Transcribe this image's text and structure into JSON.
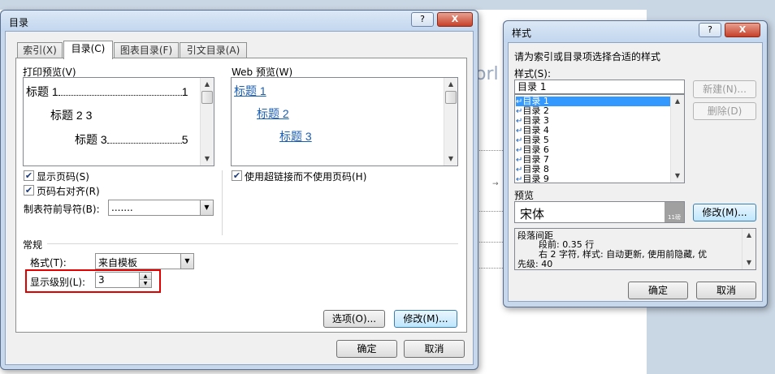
{
  "background_doc": {
    "fragment": "orl"
  },
  "toc_dialog": {
    "title": "目录",
    "title_buttons": {
      "help": "?",
      "close": "X"
    },
    "tabs": [
      {
        "label": "索引(X)",
        "active": false
      },
      {
        "label": "目录(C)",
        "active": true
      },
      {
        "label": "图表目录(F)",
        "active": false
      },
      {
        "label": "引文目录(A)",
        "active": false
      }
    ],
    "print_preview": {
      "label": "打印预览(V)",
      "lines": [
        {
          "text": "标题 1",
          "page": "1"
        },
        {
          "text": "标题 2",
          "page": "3"
        },
        {
          "text": "标题 3",
          "page": "5"
        }
      ]
    },
    "web_preview": {
      "label": "Web 预览(W)",
      "links": [
        "标题 1",
        "标题 2",
        "标题 3"
      ]
    },
    "options": {
      "show_page_numbers": {
        "label": "显示页码(S)",
        "checked": true
      },
      "right_align": {
        "label": "页码右对齐(R)",
        "checked": true
      },
      "use_hyperlinks": {
        "label": "使用超链接而不使用页码(H)",
        "checked": true
      },
      "tab_leader": {
        "label": "制表符前导符(B):",
        "value": "......."
      }
    },
    "general": {
      "heading": "常规",
      "format": {
        "label": "格式(T):",
        "value": "来自模板"
      },
      "levels": {
        "label": "显示级别(L):",
        "value": "3"
      }
    },
    "buttons": {
      "options": "选项(O)...",
      "modify": "修改(M)...",
      "ok": "确定",
      "cancel": "取消"
    }
  },
  "style_dialog": {
    "title": "样式",
    "title_buttons": {
      "help": "?",
      "close": "X"
    },
    "instruction": "请为索引或目录项选择合适的样式",
    "styles_label": "样式(S):",
    "style_input": "目录 1",
    "style_list": [
      {
        "label": "目录 1",
        "selected": true
      },
      {
        "label": "目录 2",
        "selected": false
      },
      {
        "label": "目录 3",
        "selected": false
      },
      {
        "label": "目录 4",
        "selected": false
      },
      {
        "label": "目录 5",
        "selected": false
      },
      {
        "label": "目录 6",
        "selected": false
      },
      {
        "label": "目录 7",
        "selected": false
      },
      {
        "label": "目录 8",
        "selected": false
      },
      {
        "label": "目录 9",
        "selected": false
      }
    ],
    "side_buttons": {
      "new": "新建(N)...",
      "delete": "删除(D)"
    },
    "preview_label": "预览",
    "preview_font": "宋体",
    "preview_size": "11磅",
    "modify_button": "修改(M)...",
    "description": [
      "段落间距",
      "段前: 0.35 行",
      "右  2 字符, 样式: 自动更新, 使用前隐藏, 优",
      "先级: 40"
    ],
    "buttons": {
      "ok": "确定",
      "cancel": "取消"
    }
  },
  "colors": {
    "selection": "#3399ff",
    "link": "#1b5fb5",
    "highlight_box": "#e00000"
  }
}
